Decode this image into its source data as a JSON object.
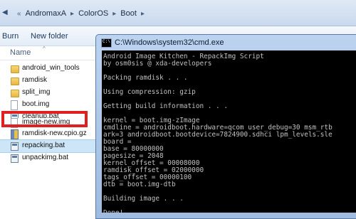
{
  "explorer": {
    "breadcrumbs": [
      "AndromaxA",
      "ColorOS",
      "Boot"
    ],
    "toolbar": {
      "burn": "Burn",
      "new_folder": "New folder"
    },
    "column_name": "Name",
    "files": [
      {
        "name": "android_win_tools",
        "icon": "folder-icon"
      },
      {
        "name": "ramdisk",
        "icon": "folder-icon"
      },
      {
        "name": "split_img",
        "icon": "folder-icon"
      },
      {
        "name": "boot.img",
        "icon": "file-icon"
      },
      {
        "name": "cleanup.bat",
        "icon": "batch-file-icon"
      },
      {
        "name": "image-new.img",
        "icon": "file-icon"
      },
      {
        "name": "ramdisk-new.cpio.gz",
        "icon": "archive-icon"
      },
      {
        "name": "repacking.bat",
        "icon": "batch-file-icon"
      },
      {
        "name": "unpackimg.bat",
        "icon": "batch-file-icon"
      }
    ],
    "highlight_color": "#e02020"
  },
  "cmd": {
    "title": "C:\\Windows\\system32\\cmd.exe",
    "lines": [
      "Android Image Kitchen - RepackImg Script",
      "by osm0sis @ xda-developers",
      "",
      "Packing ramdisk . . .",
      "",
      "Using compression: gzip",
      "",
      "Getting build information . . .",
      "",
      "kernel = boot.img-zImage",
      "cmdline = androidboot.hardware=qcom user_debug=30 msm_rtb",
      "ark=3 androidboot.bootdevice=7824900.sdhci lpm_levels.sle",
      "board =",
      "base = 80000000",
      "pagesize = 2048",
      "kernel_offset = 00008000",
      "ramdisk_offset = 02000000",
      "tags_offset = 00000100",
      "dtb = boot.img-dtb",
      "",
      "Building image . . .",
      "",
      "Done!"
    ]
  }
}
